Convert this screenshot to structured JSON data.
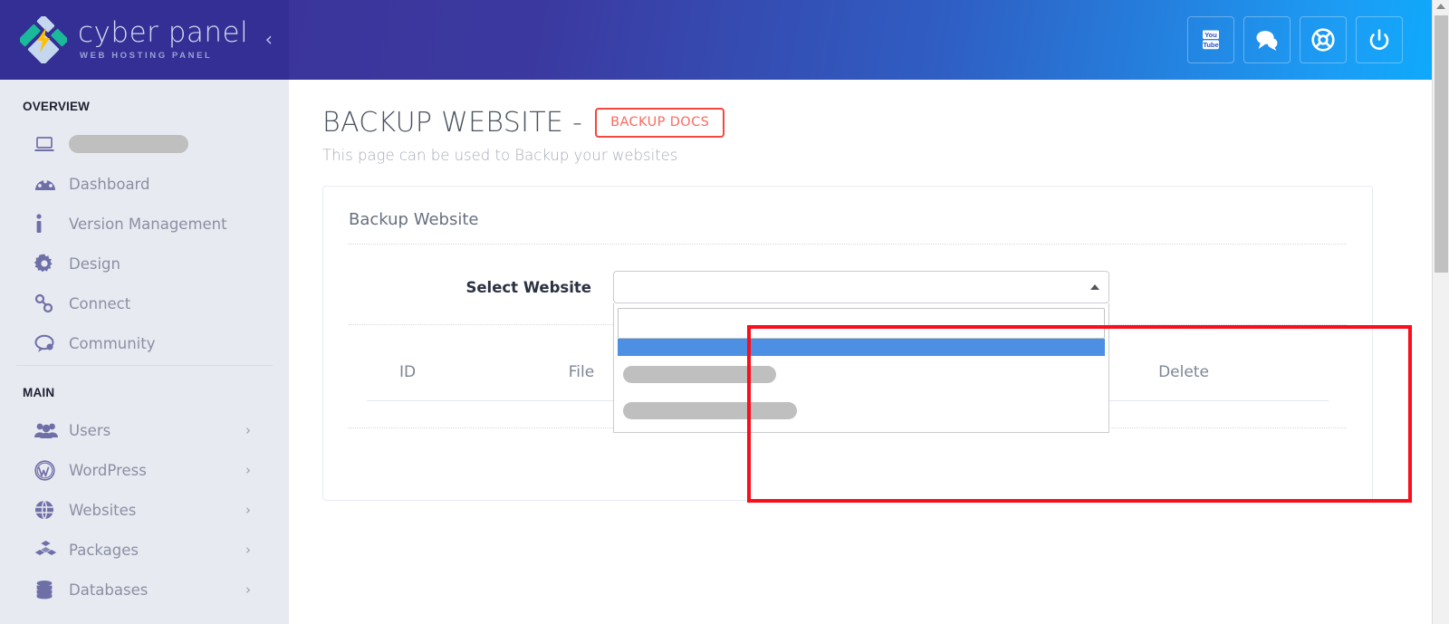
{
  "brand": {
    "title": "cyber panel",
    "subtitle": "WEB HOSTING PANEL",
    "logo_icon": "diamond-lightning-logo",
    "collapse_icon": "chevron-left-icon",
    "bg_color": "#332f94"
  },
  "topbar": {
    "gradient_from": "#3b359b",
    "gradient_to": "#0fa9fb",
    "actions": [
      {
        "name": "youtube-button",
        "icon": "youtube-icon",
        "label": ""
      },
      {
        "name": "chat-button",
        "icon": "comments-icon",
        "label": ""
      },
      {
        "name": "support-button",
        "icon": "lifebuoy-icon",
        "label": ""
      },
      {
        "name": "logout-button",
        "icon": "power-icon",
        "label": ""
      }
    ]
  },
  "sidebar": {
    "bg_color": "#e8eaf1",
    "sections": [
      {
        "title": "OVERVIEW",
        "items": [
          {
            "label": "",
            "icon": "laptop-icon",
            "redacted": true,
            "redacted_width": 132,
            "caret": false
          },
          {
            "label": "Dashboard",
            "icon": "dashboard-icon",
            "redacted": false,
            "caret": false
          },
          {
            "label": "Version Management",
            "icon": "info-icon",
            "redacted": false,
            "caret": false
          },
          {
            "label": "Design",
            "icon": "gear-icon",
            "redacted": false,
            "caret": false
          },
          {
            "label": "Connect",
            "icon": "link-icon",
            "redacted": false,
            "caret": false
          },
          {
            "label": "Community",
            "icon": "chat-bubble-icon",
            "redacted": false,
            "caret": false
          }
        ]
      },
      {
        "title": "MAIN",
        "items": [
          {
            "label": "Users",
            "icon": "users-icon",
            "redacted": false,
            "caret": true
          },
          {
            "label": "WordPress",
            "icon": "wordpress-icon",
            "redacted": false,
            "caret": true
          },
          {
            "label": "Websites",
            "icon": "globe-icon",
            "redacted": false,
            "caret": true
          },
          {
            "label": "Packages",
            "icon": "boxes-icon",
            "redacted": false,
            "caret": true
          },
          {
            "label": "Databases",
            "icon": "database-icon",
            "redacted": false,
            "caret": true
          }
        ]
      }
    ]
  },
  "page": {
    "title": "BACKUP WEBSITE -",
    "docs_button": "BACKUP DOCS",
    "docs_button_color": "#fb6a62",
    "subtitle": "This page can be used to Backup your websites"
  },
  "card": {
    "title": "Backup Website",
    "form": {
      "select_label": "Select Website",
      "select_value": "",
      "select_caret_icon": "caret-up-icon",
      "search_value": "",
      "search_placeholder": "",
      "options": [
        {
          "label": "",
          "state": "highlighted",
          "redacted": false
        },
        {
          "label": "",
          "state": "normal",
          "redacted": true,
          "redacted_width": 169
        },
        {
          "label": "",
          "state": "normal",
          "redacted": true,
          "redacted_width": 192
        }
      ]
    },
    "table": {
      "columns": [
        "ID",
        "File",
        "Delete"
      ],
      "rows": []
    }
  },
  "annotation": {
    "name": "red-highlight-box",
    "color": "#fc0d1b"
  },
  "scrollbar": {
    "orientation": "vertical",
    "up_arrow_icon": "caret-up-icon",
    "thumb_color": "#c1c1c1",
    "track_color": "#f1f1f1"
  }
}
